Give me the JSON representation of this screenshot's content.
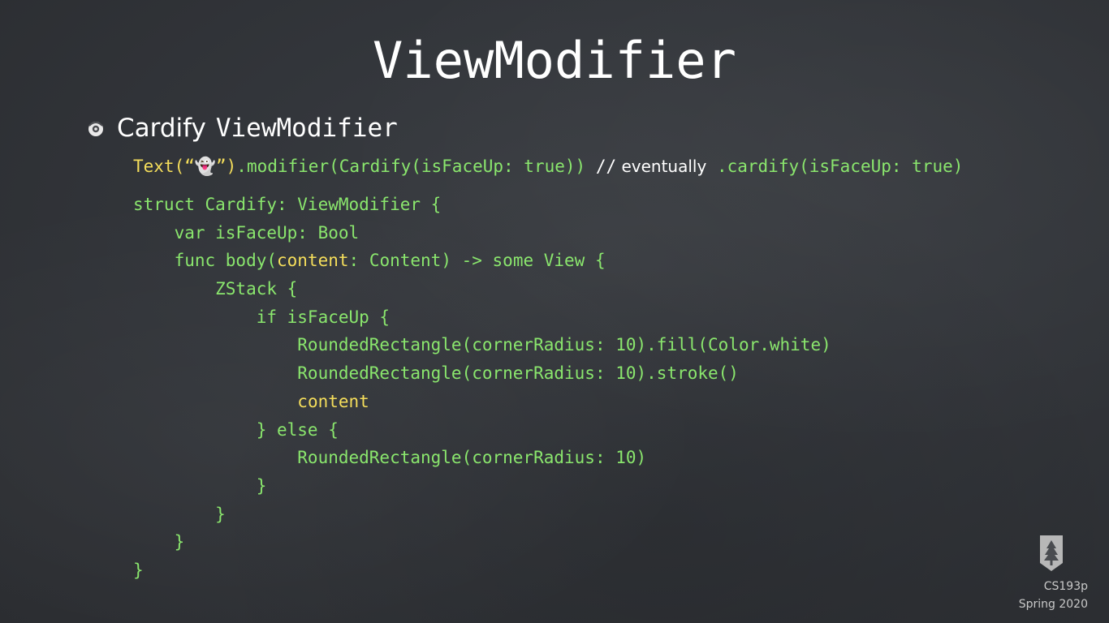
{
  "slide": {
    "title": "ViewModifier",
    "bullet_word": "Cardify",
    "bullet_code": "ViewModifier"
  },
  "usage_line": {
    "text_call": "Text(“👻”)",
    "modifier_call": ".modifier(Cardify(isFaceUp: true))",
    "comment_slashes": " //",
    "comment_word": " eventually",
    "future_call": " .cardify(isFaceUp: true)"
  },
  "code": {
    "line1": "struct Cardify: ViewModifier {",
    "line2": "    var isFaceUp: Bool",
    "line3_a": "    func body(",
    "line3_b": "content",
    "line3_c": ": Content) -> some View {",
    "line4": "        ZStack {",
    "line5": "            if isFaceUp {",
    "line6": "                RoundedRectangle(cornerRadius: 10).fill(Color.white)",
    "line7": "                RoundedRectangle(cornerRadius: 10).stroke()",
    "line8_indent": "                ",
    "line8_word": "content",
    "line9": "            } else {",
    "line10": "                RoundedRectangle(cornerRadius: 10)",
    "line11": "            }",
    "line12": "        }",
    "line13": "    }",
    "line14": "}"
  },
  "footer": {
    "course": "CS193p",
    "term": "Spring 2020",
    "logo_icon": "stanford-tree-logo"
  },
  "colors": {
    "code_green": "#8ae66d",
    "code_yellow": "#f5de5b",
    "background": "#33363b"
  }
}
